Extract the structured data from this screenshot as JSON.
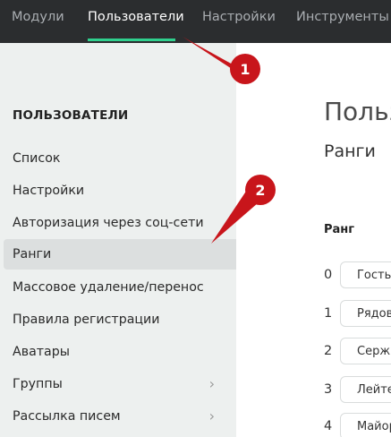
{
  "topnav": {
    "tabs": [
      {
        "label": "Модули"
      },
      {
        "label": "Пользователи"
      },
      {
        "label": "Настройки"
      },
      {
        "label": "Инструменты"
      }
    ]
  },
  "sidebar": {
    "title": "ПОЛЬЗОВАТЕЛИ",
    "items": [
      {
        "label": "Список"
      },
      {
        "label": "Настройки"
      },
      {
        "label": "Авторизация через соц-сети"
      },
      {
        "label": "Ранги"
      },
      {
        "label": "Массовое удаление/перенос"
      },
      {
        "label": "Правила регистрации"
      },
      {
        "label": "Аватары"
      },
      {
        "label": "Группы"
      },
      {
        "label": "Рассылка писем"
      }
    ]
  },
  "main": {
    "title": "Польз",
    "subtitle": "Ранги",
    "column_header": "Ранг",
    "ranks": [
      {
        "num": "0",
        "name": "Гость"
      },
      {
        "num": "1",
        "name": "Рядов"
      },
      {
        "num": "2",
        "name": "Серж"
      },
      {
        "num": "3",
        "name": "Лейте"
      },
      {
        "num": "4",
        "name": "Майор"
      }
    ]
  },
  "annotations": [
    {
      "label": "1"
    },
    {
      "label": "2"
    }
  ],
  "colors": {
    "topbar_bg": "#2b2d2f",
    "active_tab_underline": "#2fd08e",
    "annotation_red": "#c8151b"
  }
}
